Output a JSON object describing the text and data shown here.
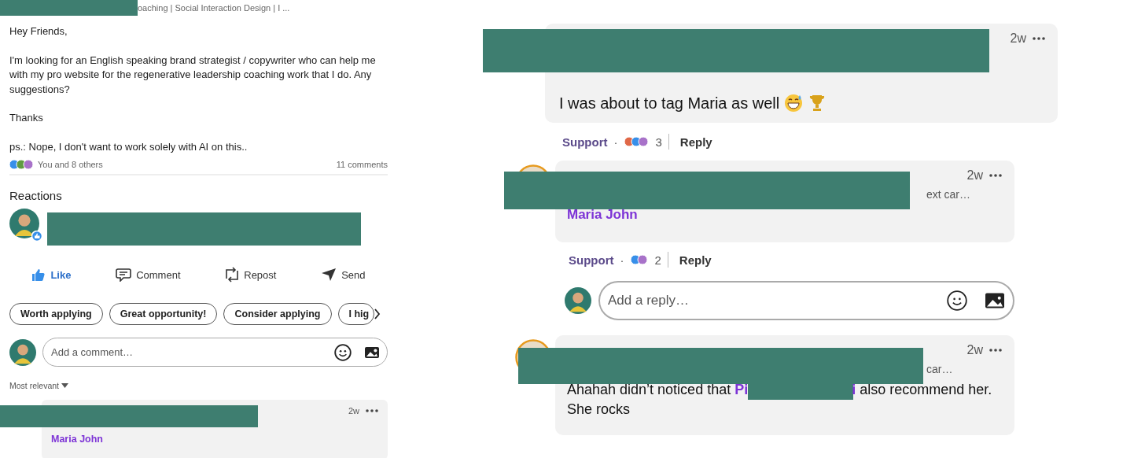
{
  "post": {
    "header_fragment": "oaching | Social Interaction Design | I ...",
    "paragraphs": [
      "Hey Friends,",
      "I'm looking for an English speaking brand strategist / copywriter who can help me with my pro website for the regenerative leadership coaching work that I do. Any suggestions?",
      "Thanks",
      "ps.: Nope, I don't want to work solely with AI on this.."
    ],
    "reactions_summary": "You and 8 others",
    "comments_count": "11 comments"
  },
  "reactions": {
    "title": "Reactions"
  },
  "actions": [
    {
      "label": "Like",
      "kind": "like",
      "selected": true
    },
    {
      "label": "Comment",
      "kind": "comment",
      "selected": false
    },
    {
      "label": "Repost",
      "kind": "repost",
      "selected": false
    },
    {
      "label": "Send",
      "kind": "send",
      "selected": false
    }
  ],
  "suggestions": [
    "Worth applying",
    "Great opportunity!",
    "Consider applying",
    "I hig"
  ],
  "comment_box": {
    "placeholder": "Add a comment…"
  },
  "sort": {
    "label": "Most relevant"
  },
  "left_comment": {
    "time": "2w",
    "mention": "Maria John"
  },
  "thread": [
    {
      "kind": "comment",
      "time": "2w",
      "body": [
        {
          "kind": "text",
          "text": "I was about to tag Maria as well"
        },
        {
          "kind": "emoji"
        },
        {
          "kind": "emoji"
        }
      ],
      "reaction": "Support",
      "separator": "·",
      "count": "3",
      "reply": "Reply"
    },
    {
      "kind": "comment",
      "time": "2w",
      "snippet": "ext car…",
      "body": [
        {
          "kind": "mention",
          "text": "Maria John"
        }
      ],
      "reaction": "Support",
      "separator": "·",
      "count": "2",
      "reply": "Reply"
    },
    {
      "kind": "reply_box",
      "placeholder": "Add a reply…"
    },
    {
      "kind": "comment",
      "time": "2w",
      "snippet": "car…",
      "body": [
        {
          "kind": "text",
          "text": "Ahahah didn’t noticed that"
        },
        {
          "kind": "mention",
          "text": "Pi"
        },
        {
          "kind": "redacted"
        },
        {
          "kind": "mention",
          "text": "i"
        },
        {
          "kind": "text",
          "text": "also recommend her. She rocks"
        }
      ]
    }
  ]
}
